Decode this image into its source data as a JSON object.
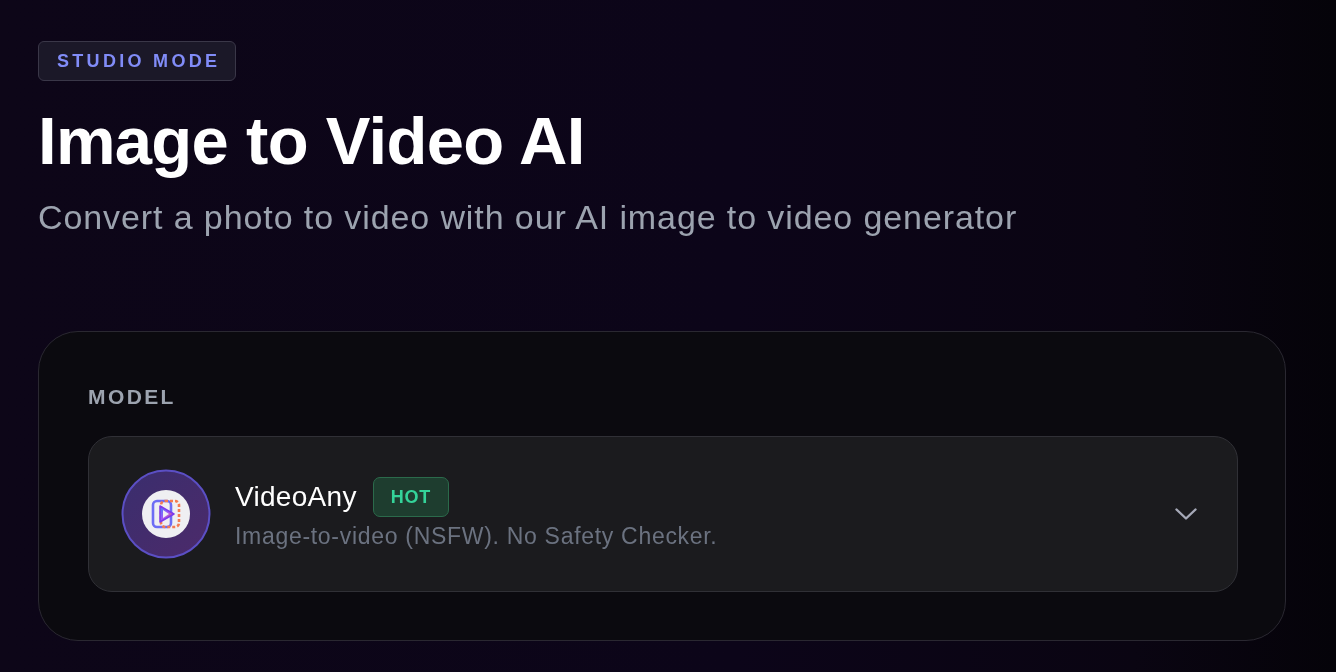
{
  "badge": "STUDIO MODE",
  "title": "Image to Video AI",
  "subtitle": "Convert a photo to video with our AI image to video generator",
  "model_section": {
    "label": "MODEL",
    "selected_model": {
      "name": "VideoAny",
      "tag": "HOT",
      "description": "Image-to-video (NSFW). No Safety Checker."
    }
  }
}
